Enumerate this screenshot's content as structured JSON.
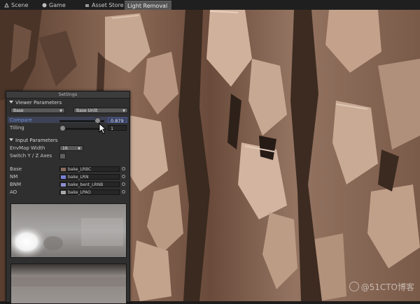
{
  "tabs": [
    {
      "label": "Scene",
      "icon": "scene-icon",
      "active": false
    },
    {
      "label": "Game",
      "icon": "game-icon",
      "active": false
    },
    {
      "label": "Asset Store",
      "icon": "asset-store-icon",
      "active": false
    },
    {
      "label": "Light Removal",
      "icon": "",
      "active": true
    }
  ],
  "panel": {
    "title": "Settings",
    "viewer": {
      "header": "Viewer Parameters",
      "base_dropdown": "Base",
      "mode_dropdown": "Base Unlit",
      "compare_label": "Compare",
      "compare_value": "0.879",
      "compare_fraction": 0.879,
      "tilling_label": "Tilling",
      "tilling_value": "1",
      "tilling_fraction": 0.0
    },
    "input": {
      "header": "Input Parameters",
      "envmap_label": "EnvMap Width",
      "envmap_value": "16",
      "swatch_label": "Switch Y / Z Axes",
      "textures": [
        {
          "label": "Base",
          "value": "bake_LRBC"
        },
        {
          "label": "NM",
          "value": "bake_LRN"
        },
        {
          "label": "BNM",
          "value": "bake_bent_LRNB"
        },
        {
          "label": "AO",
          "value": "bake_LPAO"
        }
      ]
    }
  },
  "watermark": "@51CTO博客",
  "colors": {
    "panel_bg": "#2f2f2f",
    "compare_highlight": "#3e4256",
    "accent_blue": "#6b8fd6",
    "bark_light": "#c8a58e",
    "bark_dark": "#3a2a20"
  }
}
